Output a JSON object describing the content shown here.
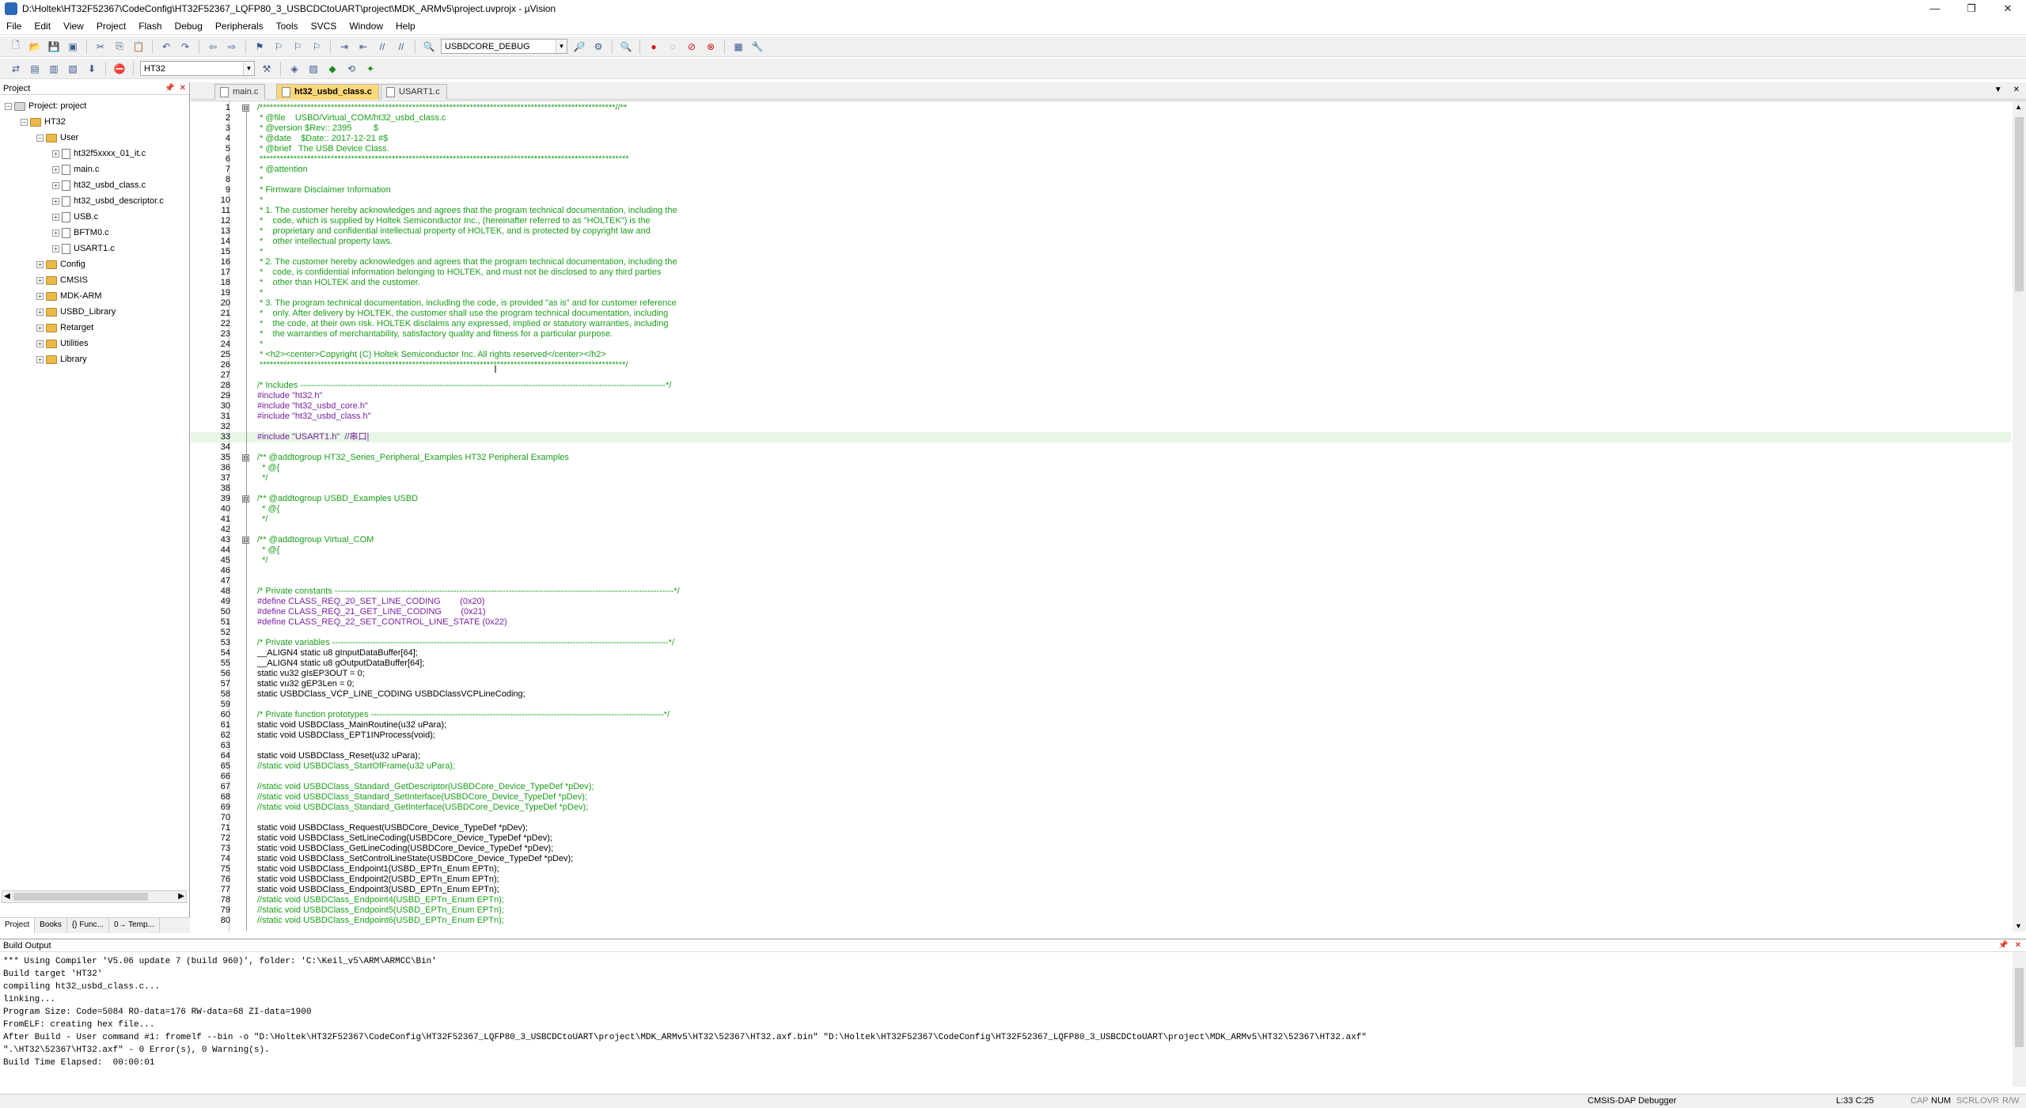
{
  "window": {
    "title": "D:\\Holtek\\HT32F52367\\CodeConfig\\HT32F52367_LQFP80_3_USBCDCtoUART\\project\\MDK_ARMv5\\project.uvprojx - µVision",
    "minimize": "—",
    "restore": "❐",
    "close": "✕"
  },
  "menu": [
    "File",
    "Edit",
    "View",
    "Project",
    "Flash",
    "Debug",
    "Peripherals",
    "Tools",
    "SVCS",
    "Window",
    "Help"
  ],
  "toolbar": {
    "target_combo": "USBDCORE_DEBUG",
    "target_name": "HT32"
  },
  "project_panel": {
    "title": "Project",
    "root": "Project: project",
    "target": "HT32",
    "group_user": "User",
    "user_files": [
      "ht32f5xxxx_01_it.c",
      "main.c",
      "ht32_usbd_class.c",
      "ht32_usbd_descriptor.c",
      "USB.c",
      "BFTM0.c",
      "USART1.c"
    ],
    "groups": [
      "Config",
      "CMSIS",
      "MDK-ARM",
      "USBD_Library",
      "Retarget",
      "Utilities",
      "Library"
    ],
    "tabs": [
      "Project",
      "Books",
      "{} Func...",
      "0→ Temp..."
    ]
  },
  "editor_tabs": [
    "main.c",
    "ht32_usbd_class.c",
    "USART1.c"
  ],
  "active_tab": "ht32_usbd_class.c",
  "code": [
    {
      "n": "1",
      "fold": "⊟",
      "t": "/*********************************************************************************************************//**",
      "c": "com"
    },
    {
      "n": "2",
      "t": " * @file    USBD/Virtual_COM/ht32_usbd_class.c",
      "c": "com"
    },
    {
      "n": "3",
      "t": " * @version $Rev:: 2395         $",
      "c": "com"
    },
    {
      "n": "4",
      "t": " * @date    $Date:: 2017-12-21 #$",
      "c": "com"
    },
    {
      "n": "5",
      "t": " * @brief   The USB Device Class.",
      "c": "com"
    },
    {
      "n": "6",
      "t": " *************************************************************************************************************",
      "c": "com"
    },
    {
      "n": "7",
      "t": " * @attention",
      "c": "com"
    },
    {
      "n": "8",
      "t": " *",
      "c": "com"
    },
    {
      "n": "9",
      "t": " * Firmware Disclaimer Information",
      "c": "com"
    },
    {
      "n": "10",
      "t": " *",
      "c": "com"
    },
    {
      "n": "11",
      "t": " * 1. The customer hereby acknowledges and agrees that the program technical documentation, including the",
      "c": "com"
    },
    {
      "n": "12",
      "t": " *    code, which is supplied by Holtek Semiconductor Inc., (hereinafter referred to as \"HOLTEK\") is the",
      "c": "com"
    },
    {
      "n": "13",
      "t": " *    proprietary and confidential intellectual property of HOLTEK, and is protected by copyright law and",
      "c": "com"
    },
    {
      "n": "14",
      "t": " *    other intellectual property laws.",
      "c": "com"
    },
    {
      "n": "15",
      "t": " *",
      "c": "com"
    },
    {
      "n": "16",
      "t": " * 2. The customer hereby acknowledges and agrees that the program technical documentation, including the",
      "c": "com"
    },
    {
      "n": "17",
      "t": " *    code, is confidential information belonging to HOLTEK, and must not be disclosed to any third parties",
      "c": "com"
    },
    {
      "n": "18",
      "t": " *    other than HOLTEK and the customer.",
      "c": "com"
    },
    {
      "n": "19",
      "t": " *",
      "c": "com"
    },
    {
      "n": "20",
      "t": " * 3. The program technical documentation, including the code, is provided \"as is\" and for customer reference",
      "c": "com"
    },
    {
      "n": "21",
      "t": " *    only. After delivery by HOLTEK, the customer shall use the program technical documentation, including",
      "c": "com"
    },
    {
      "n": "22",
      "t": " *    the code, at their own risk. HOLTEK disclaims any expressed, implied or statutory warranties, including",
      "c": "com"
    },
    {
      "n": "23",
      "t": " *    the warranties of merchantability, satisfactory quality and fitness for a particular purpose.",
      "c": "com"
    },
    {
      "n": "24",
      "t": " *",
      "c": "com"
    },
    {
      "n": "25",
      "t": " * <h2><center>Copyright (C) Holtek Semiconductor Inc. All rights reserved</center></h2>",
      "c": "com"
    },
    {
      "n": "26",
      "t": " ************************************************************************************************************/",
      "c": "com"
    },
    {
      "n": "27",
      "t": "",
      "c": "norm"
    },
    {
      "n": "28",
      "t": "/* Includes ------------------------------------------------------------------------------------------------------------------------------*/",
      "c": "com"
    },
    {
      "n": "29",
      "t": "#include \"ht32.h\"",
      "c": "pre"
    },
    {
      "n": "30",
      "t": "#include \"ht32_usbd_core.h\"",
      "c": "pre"
    },
    {
      "n": "31",
      "t": "#include \"ht32_usbd_class.h\"",
      "c": "pre"
    },
    {
      "n": "32",
      "t": "",
      "c": "norm"
    },
    {
      "n": "33",
      "t": "#include \"USART1.h\"  //串口|",
      "c": "pre"
    },
    {
      "n": "34",
      "t": "",
      "c": "norm"
    },
    {
      "n": "35",
      "fold": "⊟",
      "t": "/** @addtogroup HT32_Series_Peripheral_Examples HT32 Peripheral Examples",
      "c": "com"
    },
    {
      "n": "36",
      "t": "  * @{",
      "c": "com"
    },
    {
      "n": "37",
      "t": "  */",
      "c": "com"
    },
    {
      "n": "38",
      "t": "",
      "c": "norm"
    },
    {
      "n": "39",
      "fold": "⊟",
      "t": "/** @addtogroup USBD_Examples USBD",
      "c": "com"
    },
    {
      "n": "40",
      "t": "  * @{",
      "c": "com"
    },
    {
      "n": "41",
      "t": "  */",
      "c": "com"
    },
    {
      "n": "42",
      "t": "",
      "c": "norm"
    },
    {
      "n": "43",
      "fold": "⊟",
      "t": "/** @addtogroup Virtual_COM",
      "c": "com"
    },
    {
      "n": "44",
      "t": "  * @{",
      "c": "com"
    },
    {
      "n": "45",
      "t": "  */",
      "c": "com"
    },
    {
      "n": "46",
      "t": "",
      "c": "norm"
    },
    {
      "n": "47",
      "t": "",
      "c": "norm"
    },
    {
      "n": "48",
      "t": "/* Private constants ---------------------------------------------------------------------------------------------------------------------*/",
      "c": "com"
    },
    {
      "n": "49",
      "t": "#define CLASS_REQ_20_SET_LINE_CODING        (0x20)",
      "c": "pre"
    },
    {
      "n": "50",
      "t": "#define CLASS_REQ_21_GET_LINE_CODING        (0x21)",
      "c": "pre"
    },
    {
      "n": "51",
      "t": "#define CLASS_REQ_22_SET_CONTROL_LINE_STATE (0x22)",
      "c": "pre"
    },
    {
      "n": "52",
      "t": "",
      "c": "norm"
    },
    {
      "n": "53",
      "t": "/* Private variables --------------------------------------------------------------------------------------------------------------------*/",
      "c": "com"
    },
    {
      "n": "54",
      "t": "__ALIGN4 static u8 gInputDataBuffer[64];",
      "c": "norm"
    },
    {
      "n": "55",
      "t": "__ALIGN4 static u8 gOutputDataBuffer[64];",
      "c": "norm"
    },
    {
      "n": "56",
      "t": "static vu32 gIsEP3OUT = 0;",
      "c": "norm"
    },
    {
      "n": "57",
      "t": "static vu32 gEP3Len = 0;",
      "c": "norm"
    },
    {
      "n": "58",
      "t": "static USBDClass_VCP_LINE_CODING USBDClassVCPLineCoding;",
      "c": "norm"
    },
    {
      "n": "59",
      "t": "",
      "c": "norm"
    },
    {
      "n": "60",
      "t": "/* Private function prototypes -----------------------------------------------------------------------------------------------------*/",
      "c": "com"
    },
    {
      "n": "61",
      "t": "static void USBDClass_MainRoutine(u32 uPara);",
      "c": "norm"
    },
    {
      "n": "62",
      "t": "static void USBDClass_EPT1INProcess(void);",
      "c": "norm"
    },
    {
      "n": "63",
      "t": "",
      "c": "norm"
    },
    {
      "n": "64",
      "t": "static void USBDClass_Reset(u32 uPara);",
      "c": "norm"
    },
    {
      "n": "65",
      "t": "//static void USBDClass_StartOfFrame(u32 uPara);",
      "c": "com"
    },
    {
      "n": "66",
      "t": "",
      "c": "norm"
    },
    {
      "n": "67",
      "t": "//static void USBDClass_Standard_GetDescriptor(USBDCore_Device_TypeDef *pDev);",
      "c": "com"
    },
    {
      "n": "68",
      "t": "//static void USBDClass_Standard_SetInterface(USBDCore_Device_TypeDef *pDev);",
      "c": "com"
    },
    {
      "n": "69",
      "t": "//static void USBDClass_Standard_GetInterface(USBDCore_Device_TypeDef *pDev);",
      "c": "com"
    },
    {
      "n": "70",
      "t": "",
      "c": "norm"
    },
    {
      "n": "71",
      "t": "static void USBDClass_Request(USBDCore_Device_TypeDef *pDev);",
      "c": "norm"
    },
    {
      "n": "72",
      "t": "static void USBDClass_SetLineCoding(USBDCore_Device_TypeDef *pDev);",
      "c": "norm"
    },
    {
      "n": "73",
      "t": "static void USBDClass_GetLineCoding(USBDCore_Device_TypeDef *pDev);",
      "c": "norm"
    },
    {
      "n": "74",
      "t": "static void USBDClass_SetControlLineState(USBDCore_Device_TypeDef *pDev);",
      "c": "norm"
    },
    {
      "n": "75",
      "t": "static void USBDClass_Endpoint1(USBD_EPTn_Enum EPTn);",
      "c": "norm"
    },
    {
      "n": "76",
      "t": "static void USBDClass_Endpoint2(USBD_EPTn_Enum EPTn);",
      "c": "norm"
    },
    {
      "n": "77",
      "t": "static void USBDClass_Endpoint3(USBD_EPTn_Enum EPTn);",
      "c": "norm"
    },
    {
      "n": "78",
      "t": "//static void USBDClass_Endpoint4(USBD_EPTn_Enum EPTn);",
      "c": "com"
    },
    {
      "n": "79",
      "t": "//static void USBDClass_Endpoint5(USBD_EPTn_Enum EPTn);",
      "c": "com"
    },
    {
      "n": "80",
      "t": "//static void USBDClass_Endpoint6(USBD_EPTn_Enum EPTn);",
      "c": "com"
    }
  ],
  "build_output": {
    "title": "Build Output",
    "lines": [
      "*** Using Compiler 'V5.06 update 7 (build 960)', folder: 'C:\\Keil_v5\\ARM\\ARMCC\\Bin'",
      "Build target 'HT32'",
      "compiling ht32_usbd_class.c...",
      "linking...",
      "Program Size: Code=5084 RO-data=176 RW-data=68 ZI-data=1900",
      "FromELF: creating hex file...",
      "After Build - User command #1: fromelf --bin -o \"D:\\Holtek\\HT32F52367\\CodeConfig\\HT32F52367_LQFP80_3_USBCDCtoUART\\project\\MDK_ARMv5\\HT32\\52367\\HT32.axf.bin\" \"D:\\Holtek\\HT32F52367\\CodeConfig\\HT32F52367_LQFP80_3_USBCDCtoUART\\project\\MDK_ARMv5\\HT32\\52367\\HT32.axf\"",
      "\".\\HT32\\52367\\HT32.axf\" - 0 Error(s), 0 Warning(s).",
      "Build Time Elapsed:  00:00:01"
    ]
  },
  "status": {
    "debugger": "CMSIS-DAP Debugger",
    "position": "L:33 C:25",
    "caps": "CAP",
    "num": "NUM",
    "scrl": "SCRL",
    "ovr": "OVR",
    "rw": "R/W"
  },
  "colors": {
    "comment": "#1a9e1a",
    "preprocessor": "#7a1fa2",
    "keyword": "#1f2fd6",
    "active_tab": "#fcd878",
    "current_line": "#e8f6e8"
  }
}
